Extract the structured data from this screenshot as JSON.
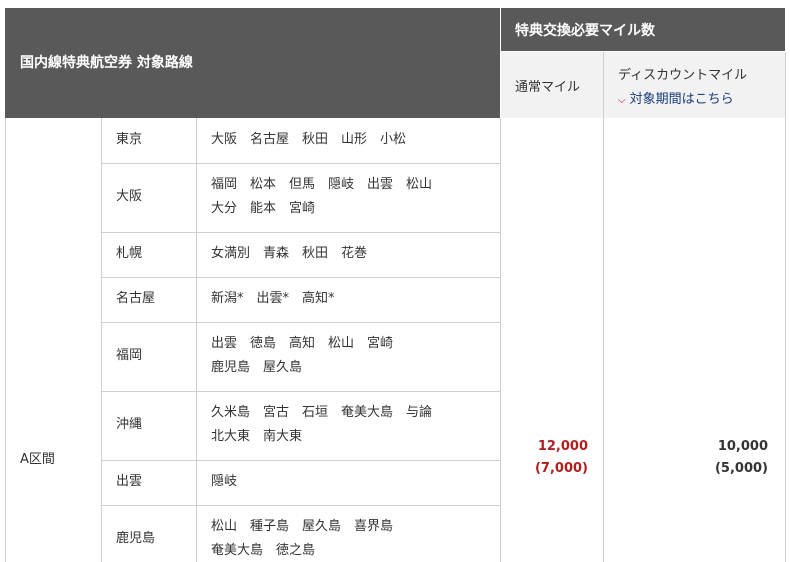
{
  "header": {
    "route_title": "国内線特典航空券 対象路線",
    "miles_title": "特典交換必要マイル数",
    "normal_miles": "通常マイル",
    "discount_miles": "ディスカウントマイル",
    "period_link": "対象期間はこちら"
  },
  "area_label": "A区間",
  "rows": [
    {
      "origin": "東京",
      "lines": [
        "大阪　名古屋　秋田　山形　小松"
      ]
    },
    {
      "origin": "大阪",
      "lines": [
        "福岡　松本　但馬　隠岐　出雲　松山",
        "大分　能本　宮崎"
      ]
    },
    {
      "origin": "札幌",
      "lines": [
        "女満別　青森　秋田　花巻"
      ]
    },
    {
      "origin": "名古屋",
      "lines": [
        "新潟*　出雲*　高知*"
      ]
    },
    {
      "origin": "福岡",
      "lines": [
        "出雲　徳島　高知　松山　宮崎",
        "鹿児島　屋久島"
      ]
    },
    {
      "origin": "沖縄",
      "lines": [
        "久米島　宮古　石垣　奄美大島　与論",
        "北大東　南大東"
      ]
    },
    {
      "origin": "出雲",
      "lines": [
        "隠岐"
      ]
    },
    {
      "origin": "鹿児島",
      "lines": [
        "松山　種子島　屋久島　喜界島",
        "奄美大島　徳之島"
      ]
    }
  ],
  "miles": {
    "normal": "12,000",
    "normal_discounted": "(7,000)",
    "discount": "10,000",
    "discount_discounted": "(5,000)"
  },
  "colors": {
    "header_bg": "#595959",
    "subheader_bg": "#f2f2f2",
    "normal_miles_text": "#b01e1e",
    "link_text": "#1a3d7c",
    "chevron": "#b30000"
  }
}
